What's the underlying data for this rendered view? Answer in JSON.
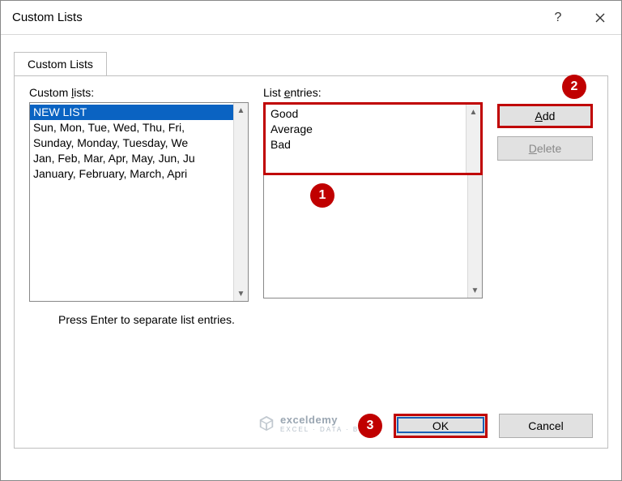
{
  "titlebar": {
    "title": "Custom Lists"
  },
  "tab": {
    "label": "Custom Lists"
  },
  "left": {
    "label_pre": "Custom ",
    "label_u": "l",
    "label_post": "ists:",
    "items": [
      "NEW LIST",
      "Sun, Mon, Tue, Wed, Thu, Fri, ",
      "Sunday, Monday, Tuesday, We",
      "Jan, Feb, Mar, Apr, May, Jun, Ju",
      "January, February, March, Apri"
    ],
    "selected_index": 0
  },
  "mid": {
    "label_pre": "List ",
    "label_u": "e",
    "label_post": "ntries:",
    "entries": [
      "Good",
      "Average",
      "Bad"
    ]
  },
  "right": {
    "add_u": "A",
    "add_post": "dd",
    "delete_u": "D",
    "delete_post": "elete"
  },
  "hint": "Press Enter to separate list entries.",
  "footer": {
    "ok": "OK",
    "cancel": "Cancel"
  },
  "badges": {
    "b1": "1",
    "b2": "2",
    "b3": "3"
  },
  "watermark": {
    "brand": "exceldemy",
    "sub": "EXCEL · DATA · BI"
  }
}
